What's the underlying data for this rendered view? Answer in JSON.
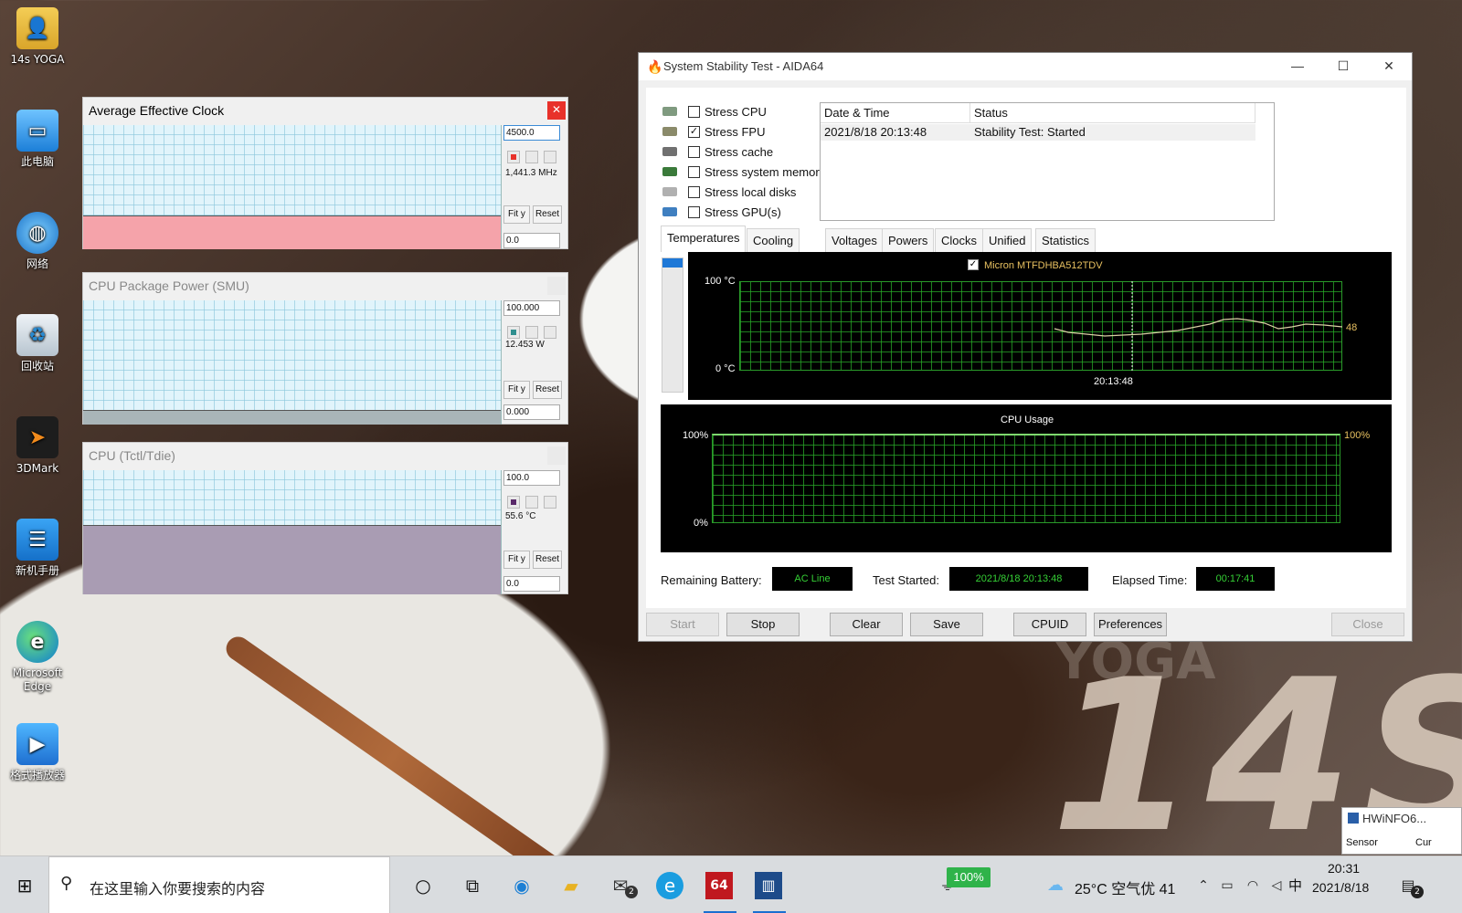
{
  "desktop": {
    "icons": [
      {
        "label": "14s YOGA",
        "icon": "folder-user-icon"
      },
      {
        "label": "此电脑",
        "icon": "computer-icon"
      },
      {
        "label": "网络",
        "icon": "network-globe-icon"
      },
      {
        "label": "回收站",
        "icon": "recycle-bin-icon"
      },
      {
        "label": "3DMark",
        "icon": "3dmark-icon"
      },
      {
        "label": "新机手册",
        "icon": "manual-icon"
      },
      {
        "label": "Microsoft Edge",
        "icon": "edge-icon"
      },
      {
        "label": "格式播放器",
        "icon": "player-icon"
      }
    ],
    "wallpaper_text": "14S",
    "wallpaper_faint": "YOGA"
  },
  "hwinfo_graphs": [
    {
      "title": "Average Effective Clock",
      "max_value": "4500.0",
      "current_value": "1,441.3 MHz",
      "min_value": "0.0",
      "fit_label": "Fit y",
      "reset_label": "Reset",
      "active": true,
      "fill_color": "#f5a3aa",
      "fill_level": 0.27,
      "swatch_color": "#e8312a"
    },
    {
      "title": "CPU Package Power (SMU)",
      "max_value": "100.000",
      "current_value": "12.453 W",
      "min_value": "0.000",
      "fit_label": "Fit y",
      "reset_label": "Reset",
      "active": false,
      "fill_color": "#a9b5b8",
      "fill_level": 0.12,
      "swatch_color": "#2f8f8f"
    },
    {
      "title": "CPU (Tctl/Tdie)",
      "max_value": "100.0",
      "current_value": "55.6 °C",
      "min_value": "0.0",
      "fit_label": "Fit y",
      "reset_label": "Reset",
      "active": false,
      "fill_color": "#a99cb3",
      "fill_level": 0.556,
      "swatch_color": "#5a2a6a"
    }
  ],
  "aida": {
    "title": "System Stability Test - AIDA64",
    "stress_options": [
      {
        "label": "Stress CPU",
        "checked": false,
        "icon": "cpu-chip-icon"
      },
      {
        "label": "Stress FPU",
        "checked": true,
        "icon": "fpu-icon"
      },
      {
        "label": "Stress cache",
        "checked": false,
        "icon": "cache-icon"
      },
      {
        "label": "Stress system memory",
        "checked": false,
        "icon": "memory-icon"
      },
      {
        "label": "Stress local disks",
        "checked": false,
        "icon": "disk-icon"
      },
      {
        "label": "Stress GPU(s)",
        "checked": false,
        "icon": "gpu-monitor-icon"
      }
    ],
    "log": {
      "headers": [
        "Date & Time",
        "Status"
      ],
      "rows": [
        [
          "2021/8/18 20:13:48",
          "Stability Test: Started"
        ]
      ]
    },
    "tabs": [
      "Temperatures",
      "Cooling Fans",
      "Voltages",
      "Powers",
      "Clocks",
      "Unified",
      "Statistics"
    ],
    "active_tab": "Temperatures",
    "temp_graph": {
      "legend": "Micron MTFDHBA512TDV",
      "y_max_label": "100 °C",
      "y_min_label": "0 °C",
      "time_label": "20:13:48",
      "current_value": "48"
    },
    "cpu_graph": {
      "title": "CPU Usage",
      "y_max_label": "100%",
      "y_min_label": "0%",
      "current_value": "100%"
    },
    "info": {
      "battery_label": "Remaining Battery:",
      "battery_value": "AC Line",
      "started_label": "Test Started:",
      "started_value": "2021/8/18 20:13:48",
      "elapsed_label": "Elapsed Time:",
      "elapsed_value": "00:17:41"
    },
    "buttons": {
      "start": "Start",
      "stop": "Stop",
      "clear": "Clear",
      "save": "Save",
      "cpuid": "CPUID",
      "preferences": "Preferences",
      "close": "Close"
    }
  },
  "hwinfo_mini": {
    "title": "HWiNFO6...",
    "col1": "Sensor",
    "col2": "Cur"
  },
  "taskbar": {
    "search_placeholder": "在这里输入你要搜索的内容",
    "mail_badge": "2",
    "battery_percent": "100%",
    "weather": "25°C 空气优 41",
    "ime": "中",
    "time": "20:31",
    "date": "2021/8/18",
    "notification_badge": "2"
  }
}
